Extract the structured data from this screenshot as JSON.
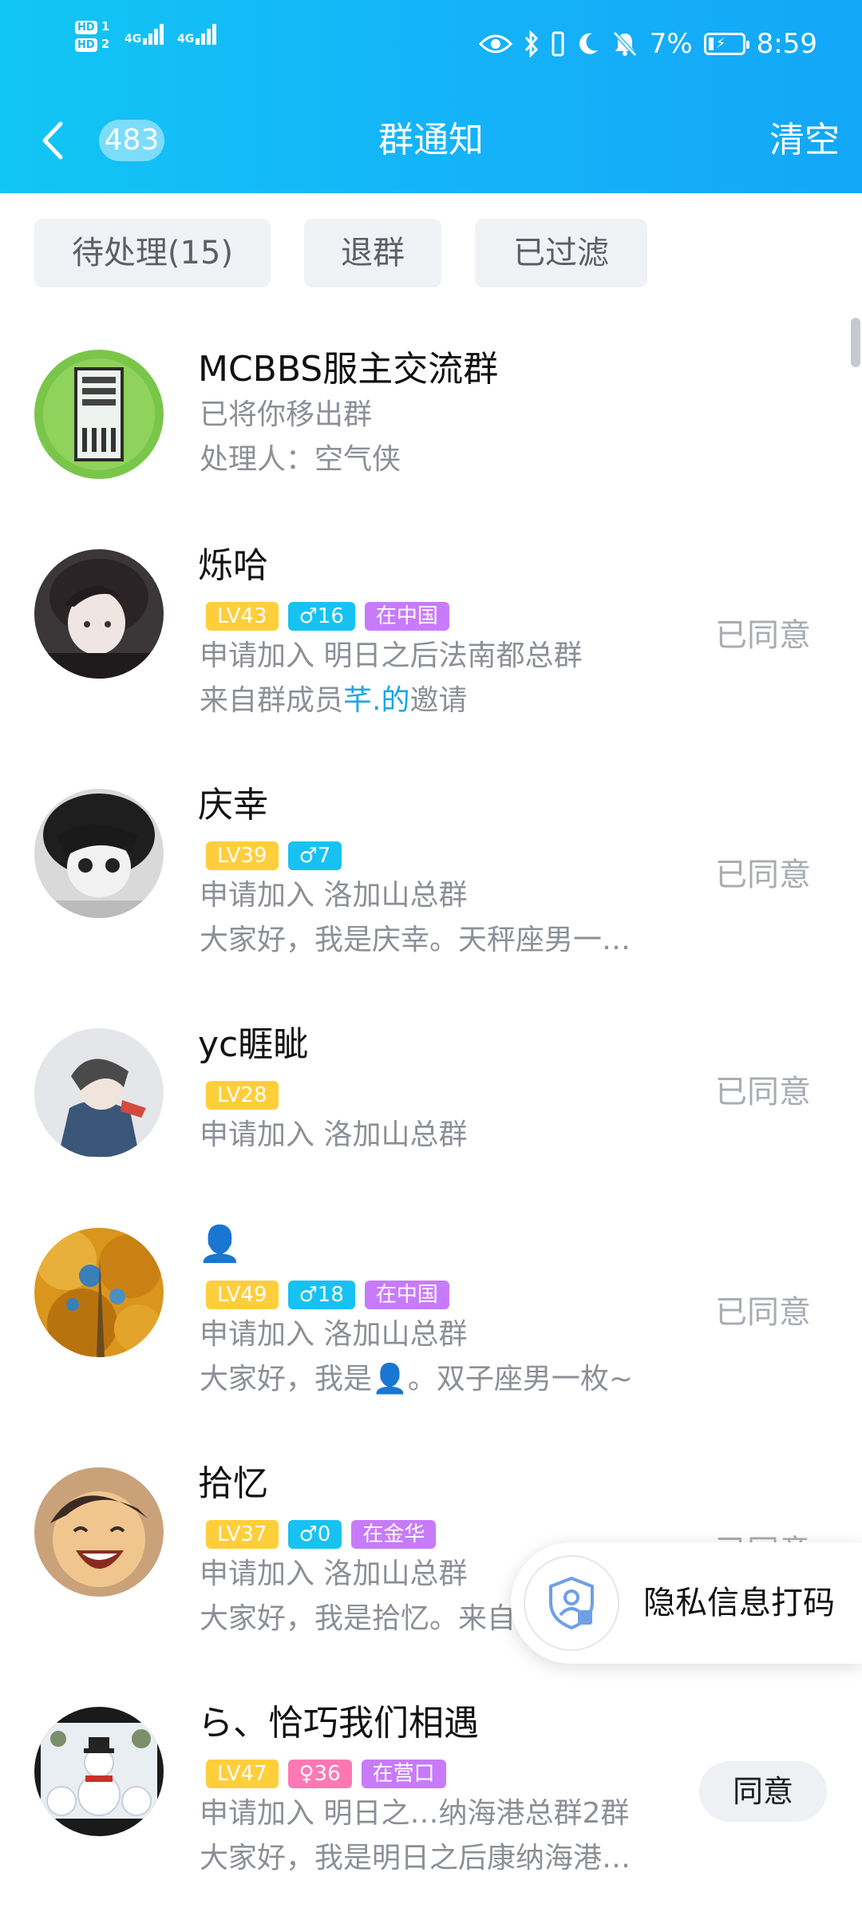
{
  "status_bar": {
    "sim1": "HD",
    "sim1_index": "1",
    "sim2": "HD",
    "sim2_index": "2",
    "network1": "4G",
    "network2": "4G",
    "battery_pct": "7%",
    "time": "8:59"
  },
  "nav": {
    "unread_count": "483",
    "title": "群通知",
    "clear_label": "清空"
  },
  "filters": [
    {
      "label": "待处理(15)"
    },
    {
      "label": "退群"
    },
    {
      "label": "已过滤"
    }
  ],
  "notifications": [
    {
      "name": "MCBBS服主交流群",
      "line1": "已将你移出群",
      "line2": "处理人：空气侠"
    },
    {
      "name": "烁哈",
      "level": "LV43",
      "gender_age": "♂16",
      "location": "在中国",
      "line1": "申请加入 明日之后法南都总群",
      "line2_prefix": "来自群成员",
      "line2_link": "芊.的",
      "line2_suffix": "邀请",
      "status": "已同意"
    },
    {
      "name": "庆幸",
      "level": "LV39",
      "gender_age": "♂7",
      "line1": "申请加入 洛加山总群",
      "line2": "大家好，我是庆幸。天秤座男一…",
      "status": "已同意"
    },
    {
      "name": "yc睚眦",
      "level": "LV28",
      "line1": "申请加入 洛加山总群",
      "status": "已同意"
    },
    {
      "name": "👤",
      "level": "LV49",
      "gender_age": "♂18",
      "location": "在中国",
      "line1": "申请加入 洛加山总群",
      "line2": "大家好，我是👤。双子座男一枚~",
      "status": "已同意"
    },
    {
      "name": "拾忆",
      "level": "LV37",
      "gender_age": "♂0",
      "location": "在金华",
      "line1": "申请加入 洛加山总群",
      "line2": "大家好，我是拾忆。来自",
      "status": "已同意"
    },
    {
      "name": "ら、恰巧我们相遇",
      "level": "LV47",
      "gender_age": "♀36",
      "location": "在营口",
      "line1": "申请加入 明日之…纳海港总群2群",
      "line2": "大家好，我是明日之后康纳海港…",
      "action": "同意"
    }
  ],
  "privacy_float": {
    "label": "隐私信息打码",
    "icon": "shield-user-icon"
  },
  "colors": {
    "header_start": "#12c6f4",
    "header_end": "#13a7f7",
    "badge_level": "#ffce3b",
    "badge_male": "#17c2f2",
    "badge_female": "#ff78b4",
    "badge_location": "#c77bfa",
    "link": "#1aa6e8"
  }
}
